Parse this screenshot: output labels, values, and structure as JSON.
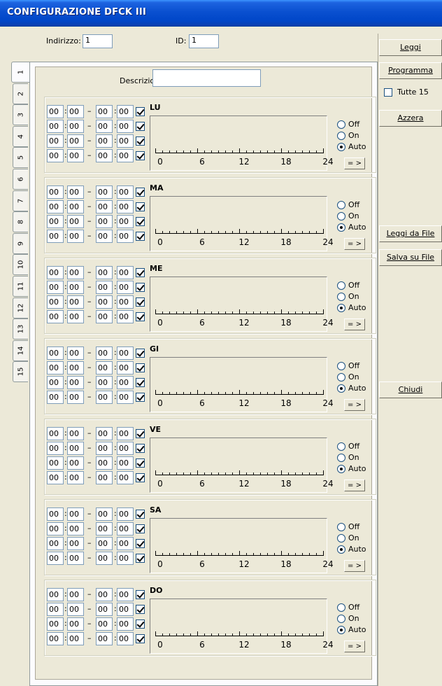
{
  "window": {
    "title": "CONFIGURAZIONE DFCK III"
  },
  "header": {
    "address_label": "Indirizzo:",
    "address_value": "1",
    "id_label": "ID:",
    "id_value": "1"
  },
  "right_panel": {
    "read_label": "Leggi",
    "program_label": "Programma",
    "all15_label": "Tutte 15",
    "reset_label": "Azzera",
    "read_file_label": "Leggi da File",
    "save_file_label": "Salva su File",
    "close_label": "Chiudi"
  },
  "tabs": [
    "1",
    "2",
    "3",
    "4",
    "5",
    "6",
    "7",
    "8",
    "9",
    "10",
    "11",
    "12",
    "13",
    "14",
    "15"
  ],
  "active_tab": "1",
  "description": {
    "label": "Descrizione:",
    "value": ""
  },
  "time_value": "00",
  "dash": "–",
  "colon": ":",
  "axis_ticks": [
    "0",
    "6",
    "12",
    "18",
    "24"
  ],
  "mode_options": {
    "off": "Off",
    "on": "On",
    "auto": "Auto"
  },
  "selected_mode": "Auto",
  "arrow_button": "= >",
  "days": [
    {
      "name": "LU"
    },
    {
      "name": "MA"
    },
    {
      "name": "ME"
    },
    {
      "name": "GI"
    },
    {
      "name": "VE"
    },
    {
      "name": "SA"
    },
    {
      "name": "DO"
    }
  ]
}
